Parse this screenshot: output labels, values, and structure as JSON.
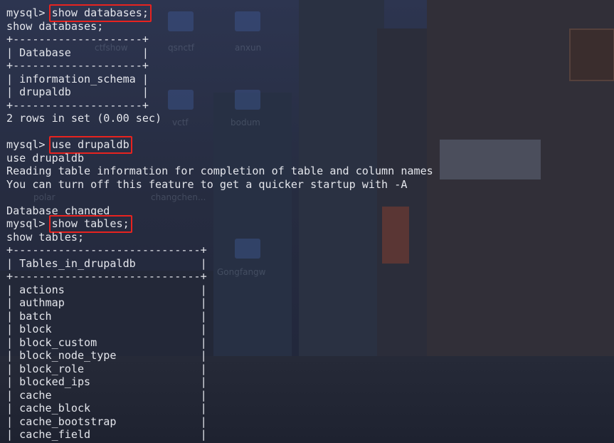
{
  "wallpaper": {
    "desktop_labels": [
      "ctfshow",
      "qsnctf",
      "anxun",
      "vctf",
      "bodum",
      "polar",
      "changchen...",
      "Gongfangw"
    ]
  },
  "terminal": {
    "prompt": "mysql>",
    "lines": [
      {
        "type": "command",
        "prompt": "mysql> ",
        "command": "show databases;",
        "highlight": true
      },
      {
        "type": "output",
        "text": "show databases;"
      },
      {
        "type": "output",
        "text": "+--------------------+"
      },
      {
        "type": "output",
        "text": "| Database           |"
      },
      {
        "type": "output",
        "text": "+--------------------+"
      },
      {
        "type": "output",
        "text": "| information_schema |"
      },
      {
        "type": "output",
        "text": "| drupaldb           |"
      },
      {
        "type": "output",
        "text": "+--------------------+"
      },
      {
        "type": "output",
        "text": "2 rows in set (0.00 sec)"
      },
      {
        "type": "output",
        "text": ""
      },
      {
        "type": "command",
        "prompt": "mysql> ",
        "command": "use drupaldb",
        "highlight": true
      },
      {
        "type": "output",
        "text": "use drupaldb"
      },
      {
        "type": "output",
        "text": "Reading table information for completion of table and column names"
      },
      {
        "type": "output",
        "text": "You can turn off this feature to get a quicker startup with -A"
      },
      {
        "type": "output",
        "text": ""
      },
      {
        "type": "output",
        "text": "Database changed"
      },
      {
        "type": "command",
        "prompt": "mysql> ",
        "command": "show tables;",
        "highlight": true
      },
      {
        "type": "output",
        "text": "show tables;"
      },
      {
        "type": "output",
        "text": "+-----------------------------+"
      },
      {
        "type": "output",
        "text": "| Tables_in_drupaldb          |"
      },
      {
        "type": "output",
        "text": "+-----------------------------+"
      },
      {
        "type": "output",
        "text": "| actions                     |"
      },
      {
        "type": "output",
        "text": "| authmap                     |"
      },
      {
        "type": "output",
        "text": "| batch                       |"
      },
      {
        "type": "output",
        "text": "| block                       |"
      },
      {
        "type": "output",
        "text": "| block_custom                |"
      },
      {
        "type": "output",
        "text": "| block_node_type             |"
      },
      {
        "type": "output",
        "text": "| block_role                  |"
      },
      {
        "type": "output",
        "text": "| blocked_ips                 |"
      },
      {
        "type": "output",
        "text": "| cache                       |"
      },
      {
        "type": "output",
        "text": "| cache_block                 |"
      },
      {
        "type": "output",
        "text": "| cache_bootstrap             |"
      },
      {
        "type": "output",
        "text": "| cache_field                 |"
      }
    ]
  },
  "colors": {
    "text": "#e4e6ec",
    "highlight_box": "#e8231f",
    "background": "#1d2233"
  }
}
